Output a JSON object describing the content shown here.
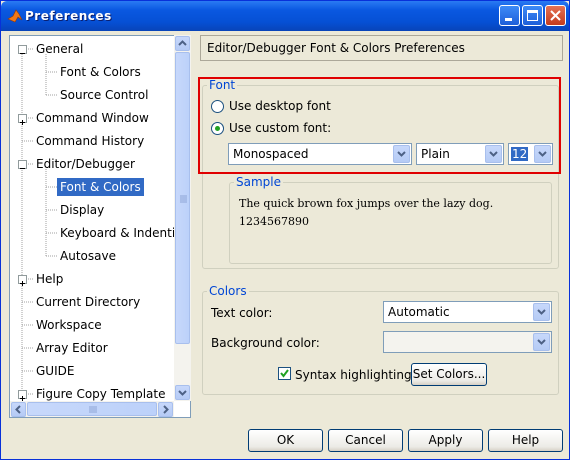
{
  "window": {
    "title": "Preferences"
  },
  "tree": {
    "items": [
      {
        "label": "General",
        "expander": "minus"
      },
      {
        "label": "Font & Colors"
      },
      {
        "label": "Source Control"
      },
      {
        "label": "Command Window",
        "expander": "plus"
      },
      {
        "label": "Command History"
      },
      {
        "label": "Editor/Debugger",
        "expander": "minus"
      },
      {
        "label": "Font & Colors",
        "selected": true
      },
      {
        "label": "Display"
      },
      {
        "label": "Keyboard & Indenting"
      },
      {
        "label": "Autosave"
      },
      {
        "label": "Help",
        "expander": "plus"
      },
      {
        "label": "Current Directory"
      },
      {
        "label": "Workspace"
      },
      {
        "label": "Array Editor"
      },
      {
        "label": "GUIDE"
      },
      {
        "label": "Figure Copy Template",
        "expander": "plus"
      }
    ]
  },
  "panel": {
    "header": "Editor/Debugger Font & Colors Preferences"
  },
  "font_group": {
    "legend": "Font",
    "desktop_label": "Use desktop font",
    "custom_label": "Use custom font:",
    "selected_option": "custom",
    "family": "Monospaced",
    "style": "Plain",
    "size": "12"
  },
  "sample": {
    "legend": "Sample",
    "line1": "The quick brown fox jumps over the lazy dog.",
    "line2": "1234567890"
  },
  "colors_group": {
    "legend": "Colors",
    "text_color_label": "Text color:",
    "text_color_value": "Automatic",
    "bg_color_label": "Background color:",
    "bg_color_value": "",
    "syntax_label": "Syntax highlighting",
    "syntax_checked": true,
    "set_colors_label": "Set Colors..."
  },
  "buttons": {
    "ok": "OK",
    "cancel": "Cancel",
    "apply": "Apply",
    "help": "Help"
  },
  "theme": {
    "titlebar": "#0a58e1",
    "selection": "#316ac5",
    "legend_blue": "#0046d5",
    "highlight_red": "#e00000"
  }
}
